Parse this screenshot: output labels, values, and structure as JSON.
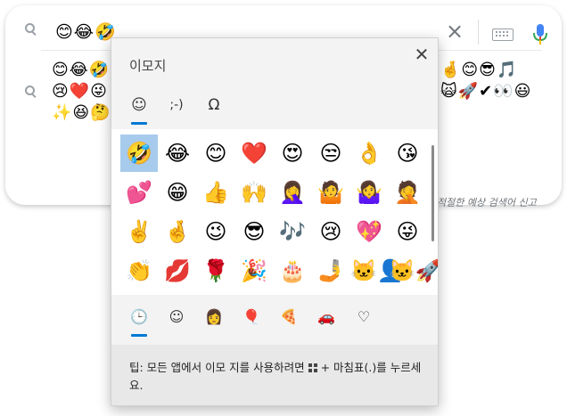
{
  "search": {
    "query": "😊😂🤣",
    "clear_symbol": "×"
  },
  "suggestions": {
    "left_lines": [
      "😊😂🤣",
      "😢❤️😜",
      "✨😆🤔"
    ],
    "right_lines": [
      "🤞😊😎🎵",
      "🙀🚀✔👀😃"
    ],
    "report_text": "적절한 예상 검색어 신고"
  },
  "emoji_panel": {
    "title": "이모지",
    "close_symbol": "✕",
    "top_tabs": [
      {
        "label": "☺",
        "name": "emoji"
      },
      {
        "label": ";-)",
        "name": "kaomoji"
      },
      {
        "label": "Ω",
        "name": "symbols"
      }
    ],
    "rows": [
      [
        "🤣",
        "😂",
        "😊",
        "❤️",
        "😍",
        "😒",
        "👌",
        "😘"
      ],
      [
        "💕",
        "😁",
        "👍",
        "🙌",
        "🤦‍♀️",
        "🤷",
        "🤷‍♀️",
        "🤦"
      ],
      [
        "✌️",
        "🤞",
        "😉",
        "😎",
        "🎶",
        "😢",
        "💖",
        "😜"
      ],
      [
        "👏",
        "💋",
        "🌹",
        "🎉",
        "🎂",
        "🤳",
        "🐱‍👤",
        "🐱‍🚀"
      ],
      [
        "💝",
        "🎁",
        "🎀",
        "🌎",
        "⚡",
        "🙀",
        "💯",
        "✨"
      ]
    ],
    "category_tabs": [
      {
        "label": "🕒",
        "name": "recent"
      },
      {
        "label": "☺",
        "name": "smileys"
      },
      {
        "label": "👩",
        "name": "people"
      },
      {
        "label": "🎈",
        "name": "celebration"
      },
      {
        "label": "🍕",
        "name": "food"
      },
      {
        "label": "🚗",
        "name": "travel"
      },
      {
        "label": "♡",
        "name": "symbols-heart"
      }
    ],
    "tip_prefix": "팁: 모든 앱에서 이모 지를 사용하려면",
    "tip_suffix": "+ 마침표(.)를 누르세요."
  }
}
